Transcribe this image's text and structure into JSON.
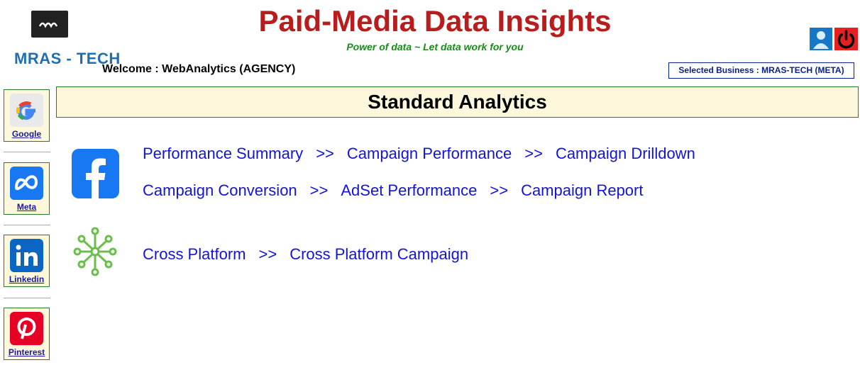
{
  "brand": {
    "logo_text": "MRAS - TECH"
  },
  "header": {
    "title": "Paid-Media Data Insights",
    "tagline": "Power of data ~ Let data work for you",
    "welcome": "Welcome : WebAnalytics (AGENCY)",
    "selected_business": "Selected Business : MRAS-TECH (META)"
  },
  "sidebar": {
    "items": [
      {
        "label": "Google",
        "icon": "google-icon"
      },
      {
        "label": "Meta",
        "icon": "meta-icon"
      },
      {
        "label": "Linkedin",
        "icon": "linkedin-icon"
      },
      {
        "label": "Pinterest",
        "icon": "pinterest-icon"
      }
    ]
  },
  "main": {
    "banner": "Standard Analytics",
    "separator": ">>",
    "facebook_links_row1": [
      "Performance Summary",
      "Campaign Performance",
      "Campaign Drilldown"
    ],
    "facebook_links_row2": [
      "Campaign Conversion",
      "AdSet Performance",
      "Campaign Report"
    ],
    "cross_links": [
      "Cross Platform",
      "Cross Platform Campaign"
    ]
  },
  "colors": {
    "title": "#b81c1c",
    "tagline": "#1a8a1a",
    "link": "#1414d6",
    "panel_bg": "#fdf7dc",
    "panel_border": "#2d7b2d"
  }
}
